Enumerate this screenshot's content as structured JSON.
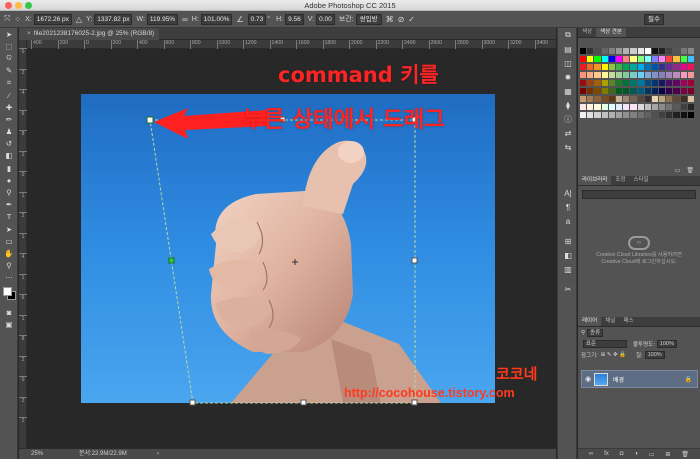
{
  "app": {
    "title": "Adobe Photoshop CC 2015"
  },
  "options_bar": {
    "x_label": "X:",
    "x_value": "1672.26 px",
    "y_label": "Y:",
    "y_value": "1337.82 px",
    "w_label": "W:",
    "w_value": "119.95%",
    "h_label": "H:",
    "h_value": "101.00%",
    "angle_value": "0.73",
    "hskew_label": "H:",
    "hskew_value": "9.56",
    "vskew_label": "V:",
    "vskew_value": "0.00",
    "interp_label": "보간:",
    "interp_value": "쌍입방",
    "workspace_value": "필수"
  },
  "document": {
    "tab_label": "file20212381760​25-2.jpg @ 25% (RGB/8)",
    "ruler_h": [
      "400",
      "200",
      "0",
      "200",
      "400",
      "600",
      "800",
      "1000",
      "1200",
      "1400",
      "1600",
      "1800",
      "2000",
      "2200",
      "2400",
      "2600",
      "2800",
      "3000",
      "3200",
      "3400",
      "3600",
      "3800"
    ],
    "ruler_v": [
      "0",
      "2",
      "4",
      "6",
      "8",
      "1",
      "0",
      "1",
      "2",
      "1",
      "4",
      "1",
      "6",
      "1",
      "8",
      "2",
      "0",
      "2",
      "2"
    ]
  },
  "annotation": {
    "line1": "command 키를",
    "line2": "누른 상태에서 드래그",
    "color": "#ff2424"
  },
  "watermark": {
    "name": "코코네",
    "url": "http://cocohouse.tistory.com",
    "color": "#ff3a1e"
  },
  "status_bar": {
    "zoom": "25%",
    "doc_size": "문서:22.9M/22.9M"
  },
  "swatches_panel": {
    "tabs": [
      "색상",
      "색상 견본"
    ]
  },
  "libraries_panel": {
    "tabs": [
      "라이브러리",
      "조정",
      "스타일"
    ],
    "message_line1": "Creative Cloud Libraries를 사용하려면",
    "message_line2": "Creative Cloud에 로그인하십시오.",
    "icon": "creative-cloud-icon"
  },
  "layers_panel": {
    "tabs": [
      "레이어",
      "채널",
      "패스"
    ],
    "filter_label": "종류",
    "blend_mode": "표준",
    "opacity_label": "불투명도:",
    "opacity_value": "100%",
    "lock_label": "잠그기:",
    "fill_label": "칠:",
    "fill_value": "100%",
    "layer_name": "배경",
    "layer_selected_color": "#5f6d84"
  }
}
